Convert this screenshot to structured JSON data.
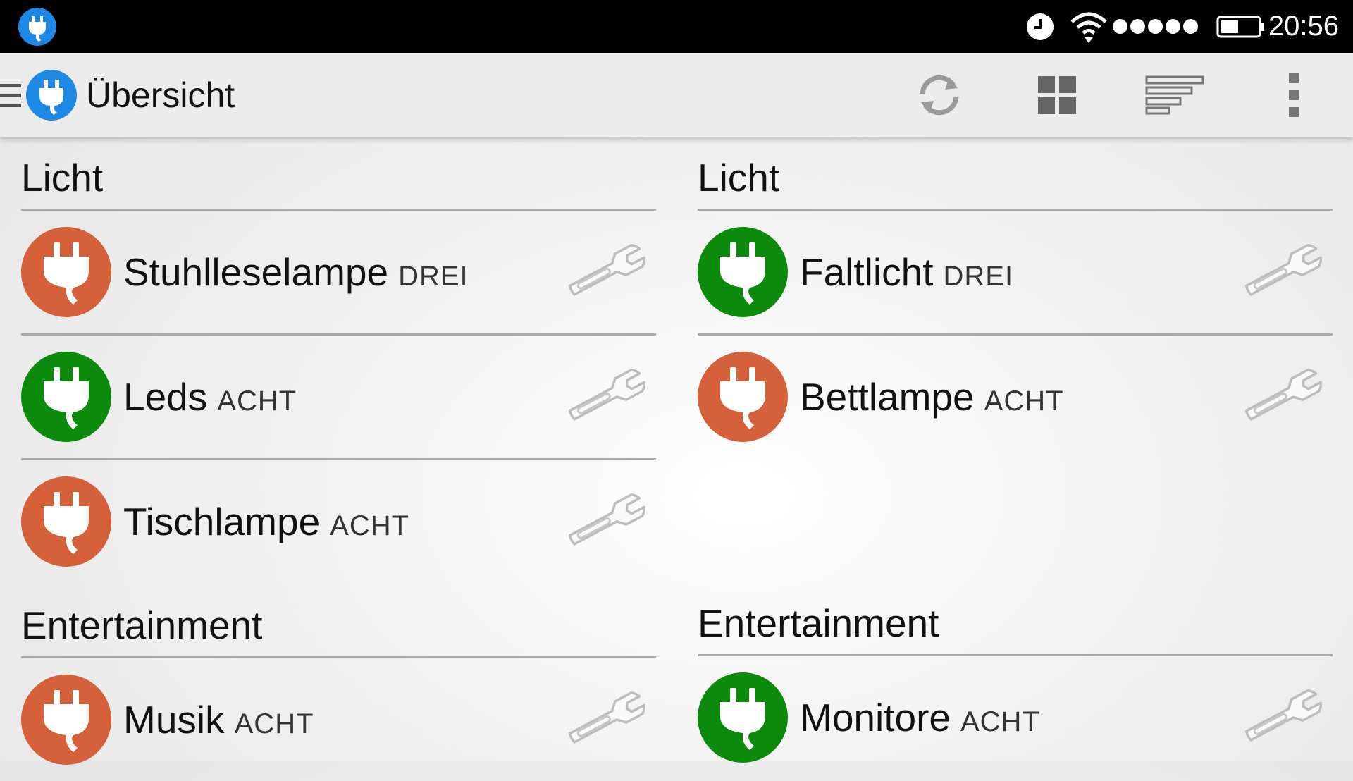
{
  "statusbar": {
    "time": "20:56",
    "icons": [
      "plug-icon",
      "alarm-clock-icon",
      "wifi-icon",
      "signal-dots-icon",
      "battery-icon"
    ]
  },
  "appbar": {
    "title": "Übersicht",
    "actions": [
      "refresh-icon",
      "grid-view-icon",
      "sort-icon",
      "overflow-menu-icon"
    ]
  },
  "colors": {
    "on": "#0b8a0b",
    "off": "#d4613a",
    "accent": "#1e88e5"
  },
  "left": {
    "sections": [
      {
        "title": "Licht",
        "devices": [
          {
            "name": "Stuhlleselampe",
            "room": "DREI",
            "state": "off"
          },
          {
            "name": "Leds",
            "room": "ACHT",
            "state": "on"
          },
          {
            "name": "Tischlampe",
            "room": "ACHT",
            "state": "off"
          }
        ]
      },
      {
        "title": "Entertainment",
        "devices": [
          {
            "name": "Musik",
            "room": "ACHT",
            "state": "off"
          }
        ]
      }
    ]
  },
  "right": {
    "sections": [
      {
        "title": "Licht",
        "devices": [
          {
            "name": "Faltlicht",
            "room": "DREI",
            "state": "on"
          },
          {
            "name": "Bettlampe",
            "room": "ACHT",
            "state": "off"
          }
        ]
      },
      {
        "title": "Entertainment",
        "devices": [
          {
            "name": "Monitore",
            "room": "ACHT",
            "state": "on"
          }
        ]
      }
    ]
  }
}
